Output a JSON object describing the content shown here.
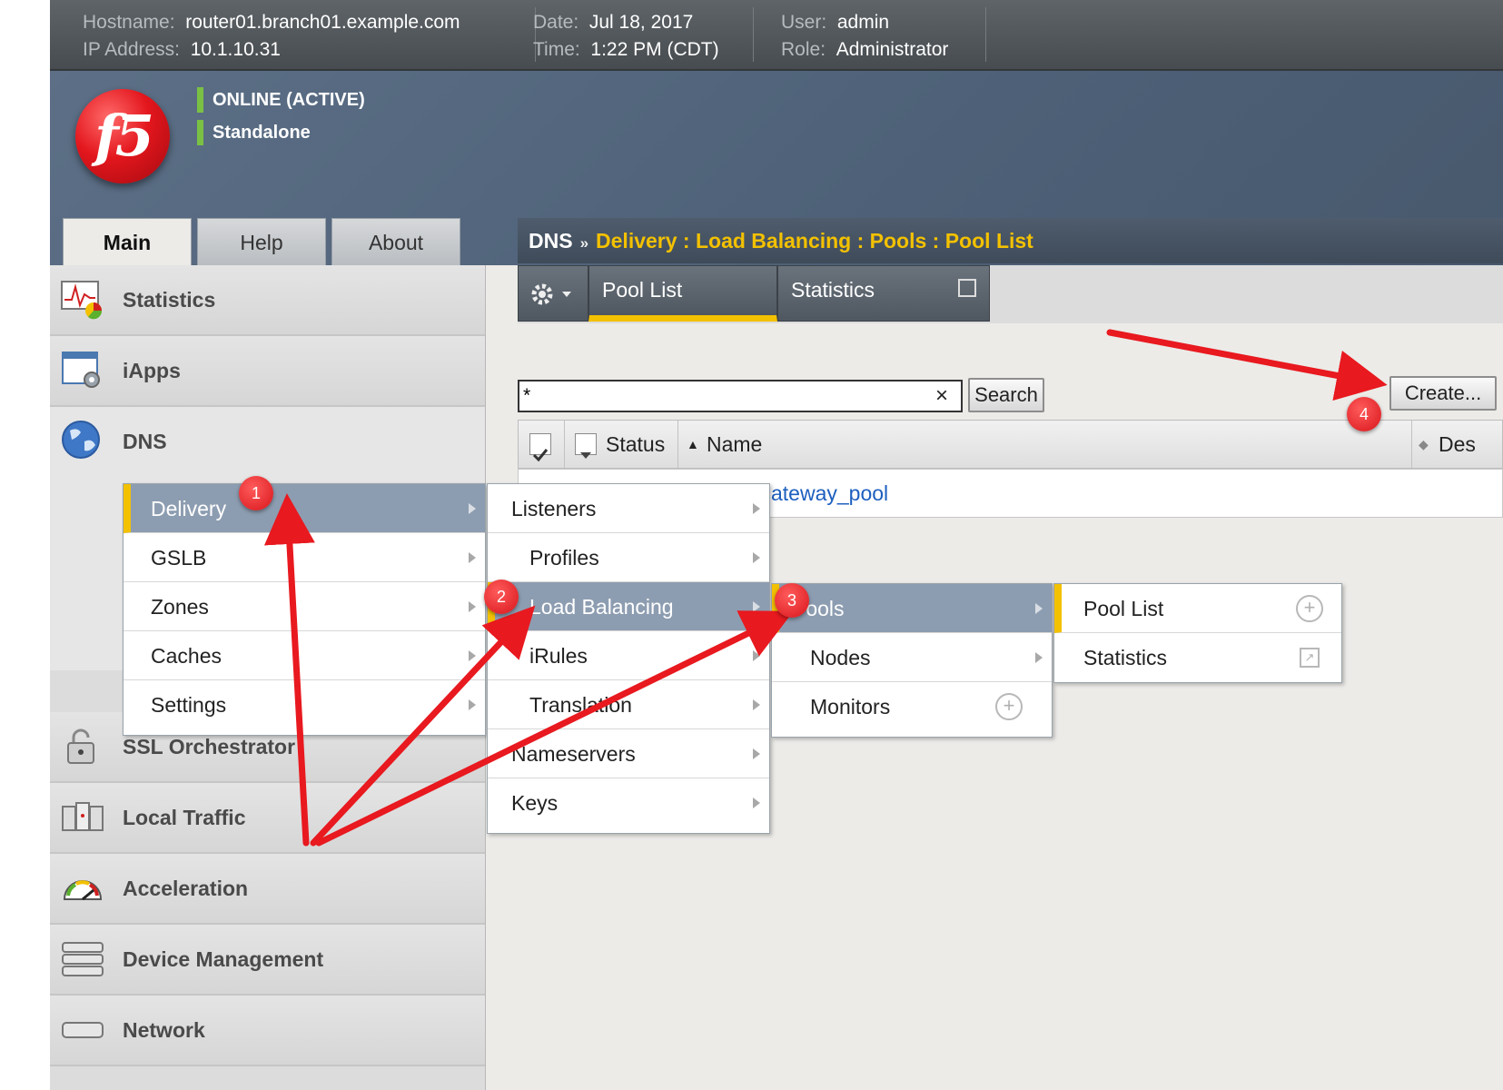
{
  "header": {
    "hostname_label": "Hostname:",
    "hostname": "router01.branch01.example.com",
    "ip_label": "IP Address:",
    "ip": "10.1.10.31",
    "date_label": "Date:",
    "date": "Jul 18, 2017",
    "time_label": "Time:",
    "time": "1:22 PM (CDT)",
    "user_label": "User:",
    "user": "admin",
    "role_label": "Role:",
    "role": "Administrator"
  },
  "banner": {
    "logo_text": "f5",
    "status_online": "ONLINE (ACTIVE)",
    "status_mode": "Standalone"
  },
  "tabs": [
    "Main",
    "Help",
    "About"
  ],
  "breadcrumb": {
    "root": "DNS",
    "separator": "»",
    "path": "Delivery : Load Balancing : Pools : Pool List"
  },
  "nav": {
    "statistics": "Statistics",
    "iapps": "iApps",
    "dns": "DNS",
    "ssl": "SSL Orchestrator",
    "local_traffic": "Local Traffic",
    "acceleration": "Acceleration",
    "device_management": "Device Management",
    "network": "Network"
  },
  "subtabs": {
    "pool_list": "Pool List",
    "statistics": "Statistics"
  },
  "search": {
    "value": "*",
    "clear": "×",
    "button": "Search"
  },
  "create_button": "Create...",
  "table": {
    "status_col": "Status",
    "name_col": "Name",
    "desc_col": "Des",
    "row_name": "ateway_pool"
  },
  "menu1": [
    "Delivery",
    "GSLB",
    "Zones",
    "Caches",
    "Settings"
  ],
  "menu2": [
    "Listeners",
    "Profiles",
    "Load Balancing",
    "iRules",
    "Translation",
    "Nameservers",
    "Keys"
  ],
  "menu3": [
    "Pools",
    "Nodes",
    "Monitors"
  ],
  "menu4": [
    "Pool List",
    "Statistics"
  ],
  "badges": [
    "1",
    "2",
    "3",
    "4"
  ],
  "colors": {
    "accent_yellow": "#f3c100",
    "status_green": "#7ac143",
    "menu_selected": "#8d9db1",
    "annotation_red": "#e8191f",
    "link_blue": "#1d5fbf"
  }
}
